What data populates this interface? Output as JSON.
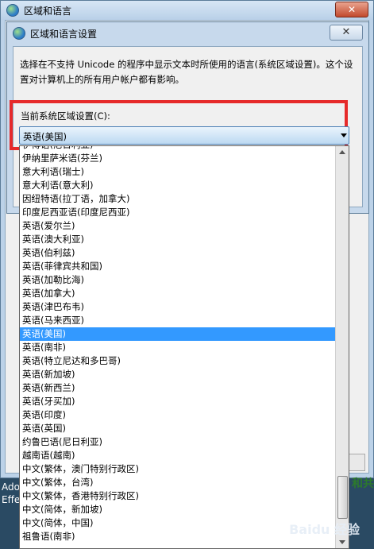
{
  "outer_window": {
    "title": "区域和语言",
    "close_label": "✕"
  },
  "dialog": {
    "title": "区域和语言设置",
    "close_label": "✕",
    "description": "选择在不支持 Unicode 的程序中显示文本时所使用的语言(系统区域设置)。这个设置对计算机上的所有用户帐户都有影响。"
  },
  "locale_setting": {
    "label": "当前系统区域设置(C):",
    "value": "英语(美国)"
  },
  "dropdown": {
    "items": [
      "伊博语(尼日利亚)",
      "伊纳里萨米语(芬兰)",
      "意大利语(瑞士)",
      "意大利语(意大利)",
      "因纽特语(拉丁语，加拿大)",
      "印度尼西亚语(印度尼西亚)",
      "英语(爱尔兰)",
      "英语(澳大利亚)",
      "英语(伯利兹)",
      "英语(菲律宾共和国)",
      "英语(加勒比海)",
      "英语(加拿大)",
      "英语(津巴布韦)",
      "英语(马来西亚)",
      "英语(美国)",
      "英语(南非)",
      "英语(特立尼达和多巴哥)",
      "英语(新加坡)",
      "英语(新西兰)",
      "英语(牙买加)",
      "英语(印度)",
      "英语(英国)",
      "约鲁巴语(尼日利亚)",
      "越南语(越南)",
      "中文(繁体，澳门特别行政区)",
      "中文(繁体，台湾)",
      "中文(繁体，香港特别行政区)",
      "中文(简体，新加坡)",
      "中文(简体，中国)",
      "祖鲁语(南非)"
    ],
    "selected_index": 14
  },
  "desktop": {
    "line1": "Ado",
    "line2": "Effe",
    "right_text": "和共"
  },
  "watermark": "Baidu 经验",
  "colors": {
    "highlight_border": "#e62a2a",
    "selected_bg": "#3399ff"
  }
}
